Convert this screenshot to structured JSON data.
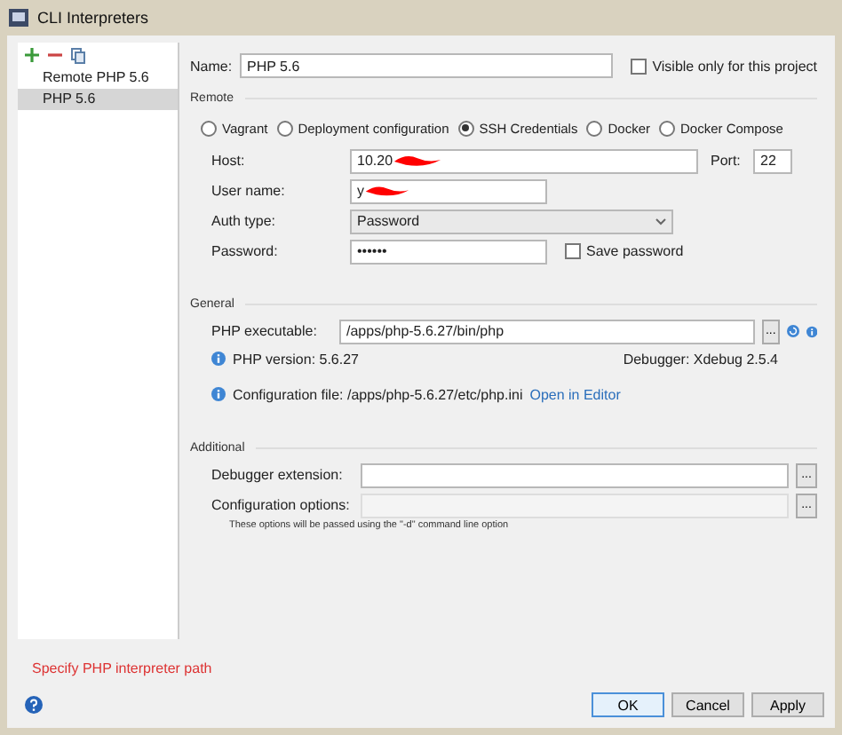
{
  "window": {
    "title": "CLI Interpreters"
  },
  "sidebar": {
    "items": [
      {
        "label": "Remote PHP 5.6",
        "selected": false
      },
      {
        "label": "PHP 5.6",
        "selected": true
      }
    ]
  },
  "name": {
    "label": "Name:",
    "value": "PHP 5.6"
  },
  "visible_only": {
    "label": "Visible only for this project",
    "checked": false
  },
  "remote": {
    "title": "Remote",
    "options": [
      {
        "label": "Vagrant",
        "selected": false
      },
      {
        "label": "Deployment configuration",
        "selected": false
      },
      {
        "label": "SSH Credentials",
        "selected": true
      },
      {
        "label": "Docker",
        "selected": false
      },
      {
        "label": "Docker Compose",
        "selected": false
      }
    ],
    "host": {
      "label": "Host:",
      "value": "10.20",
      "redacted": true
    },
    "port": {
      "label": "Port:",
      "value": "22"
    },
    "user": {
      "label": "User name:",
      "value": "y",
      "redacted": true
    },
    "auth": {
      "label": "Auth type:",
      "value": "Password"
    },
    "password": {
      "label": "Password:",
      "value": "••••••"
    },
    "save_password": {
      "label": "Save password",
      "checked": false
    }
  },
  "general": {
    "title": "General",
    "executable": {
      "label": "PHP executable:",
      "value": "/apps/php-5.6.27/bin/php",
      "browse": "..."
    },
    "version": "PHP version: 5.6.27",
    "debugger": "Debugger: Xdebug 2.5.4",
    "config": "Configuration file: /apps/php-5.6.27/etc/php.ini",
    "open_link": "Open in Editor"
  },
  "additional": {
    "title": "Additional",
    "fields": [
      {
        "label": "Debugger extension:",
        "disabled": false,
        "browse": "..."
      },
      {
        "label": "Configuration options:",
        "disabled": true,
        "browse": "..."
      }
    ],
    "note": "These options will be passed using the \"-d\" command line option"
  },
  "error": "Specify PHP interpreter path",
  "buttons": [
    {
      "label": "OK",
      "default": true
    },
    {
      "label": "Cancel",
      "default": false
    },
    {
      "label": "Apply",
      "default": false
    }
  ]
}
